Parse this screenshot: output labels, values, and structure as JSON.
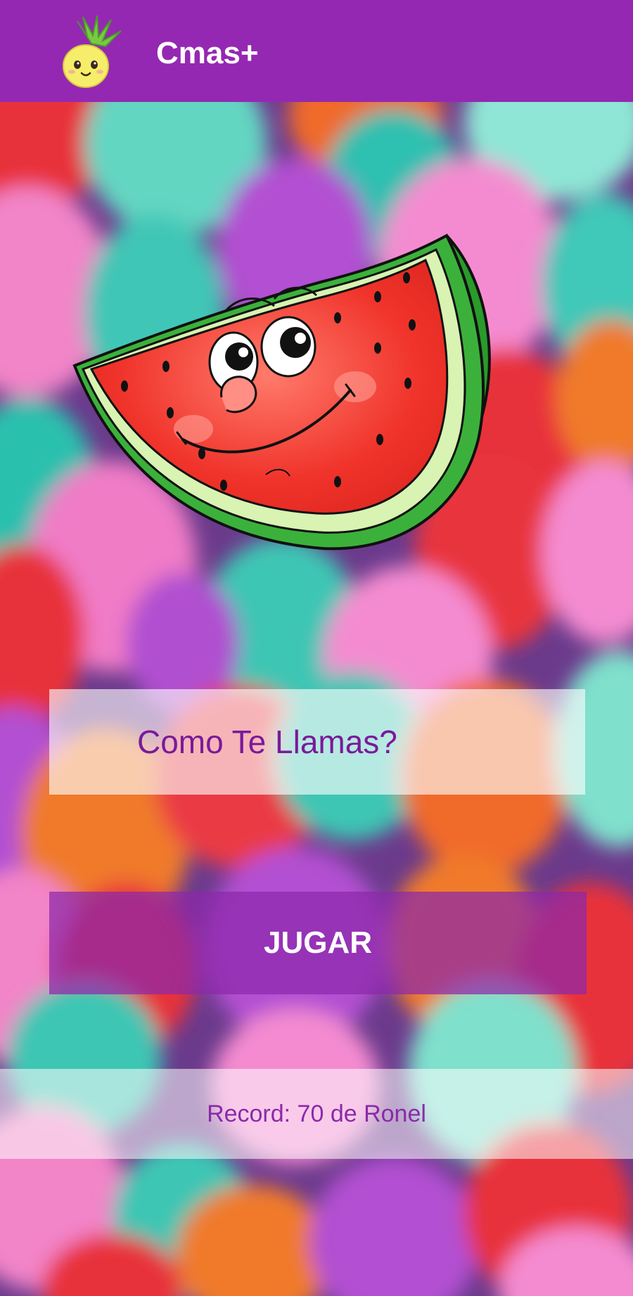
{
  "app_bar": {
    "title": "Cmas+",
    "logo_icon": "pineapple-icon",
    "background_color": "#9528b2"
  },
  "mascot": {
    "icon": "watermelon-mascot"
  },
  "name_field": {
    "placeholder": "Como Te Llamas?",
    "value": ""
  },
  "play_button": {
    "label": "JUGAR"
  },
  "record": {
    "text": "Record: 70 de Ronel"
  },
  "colors": {
    "accent": "#9528b2",
    "text_purple": "#7a1a9a"
  }
}
